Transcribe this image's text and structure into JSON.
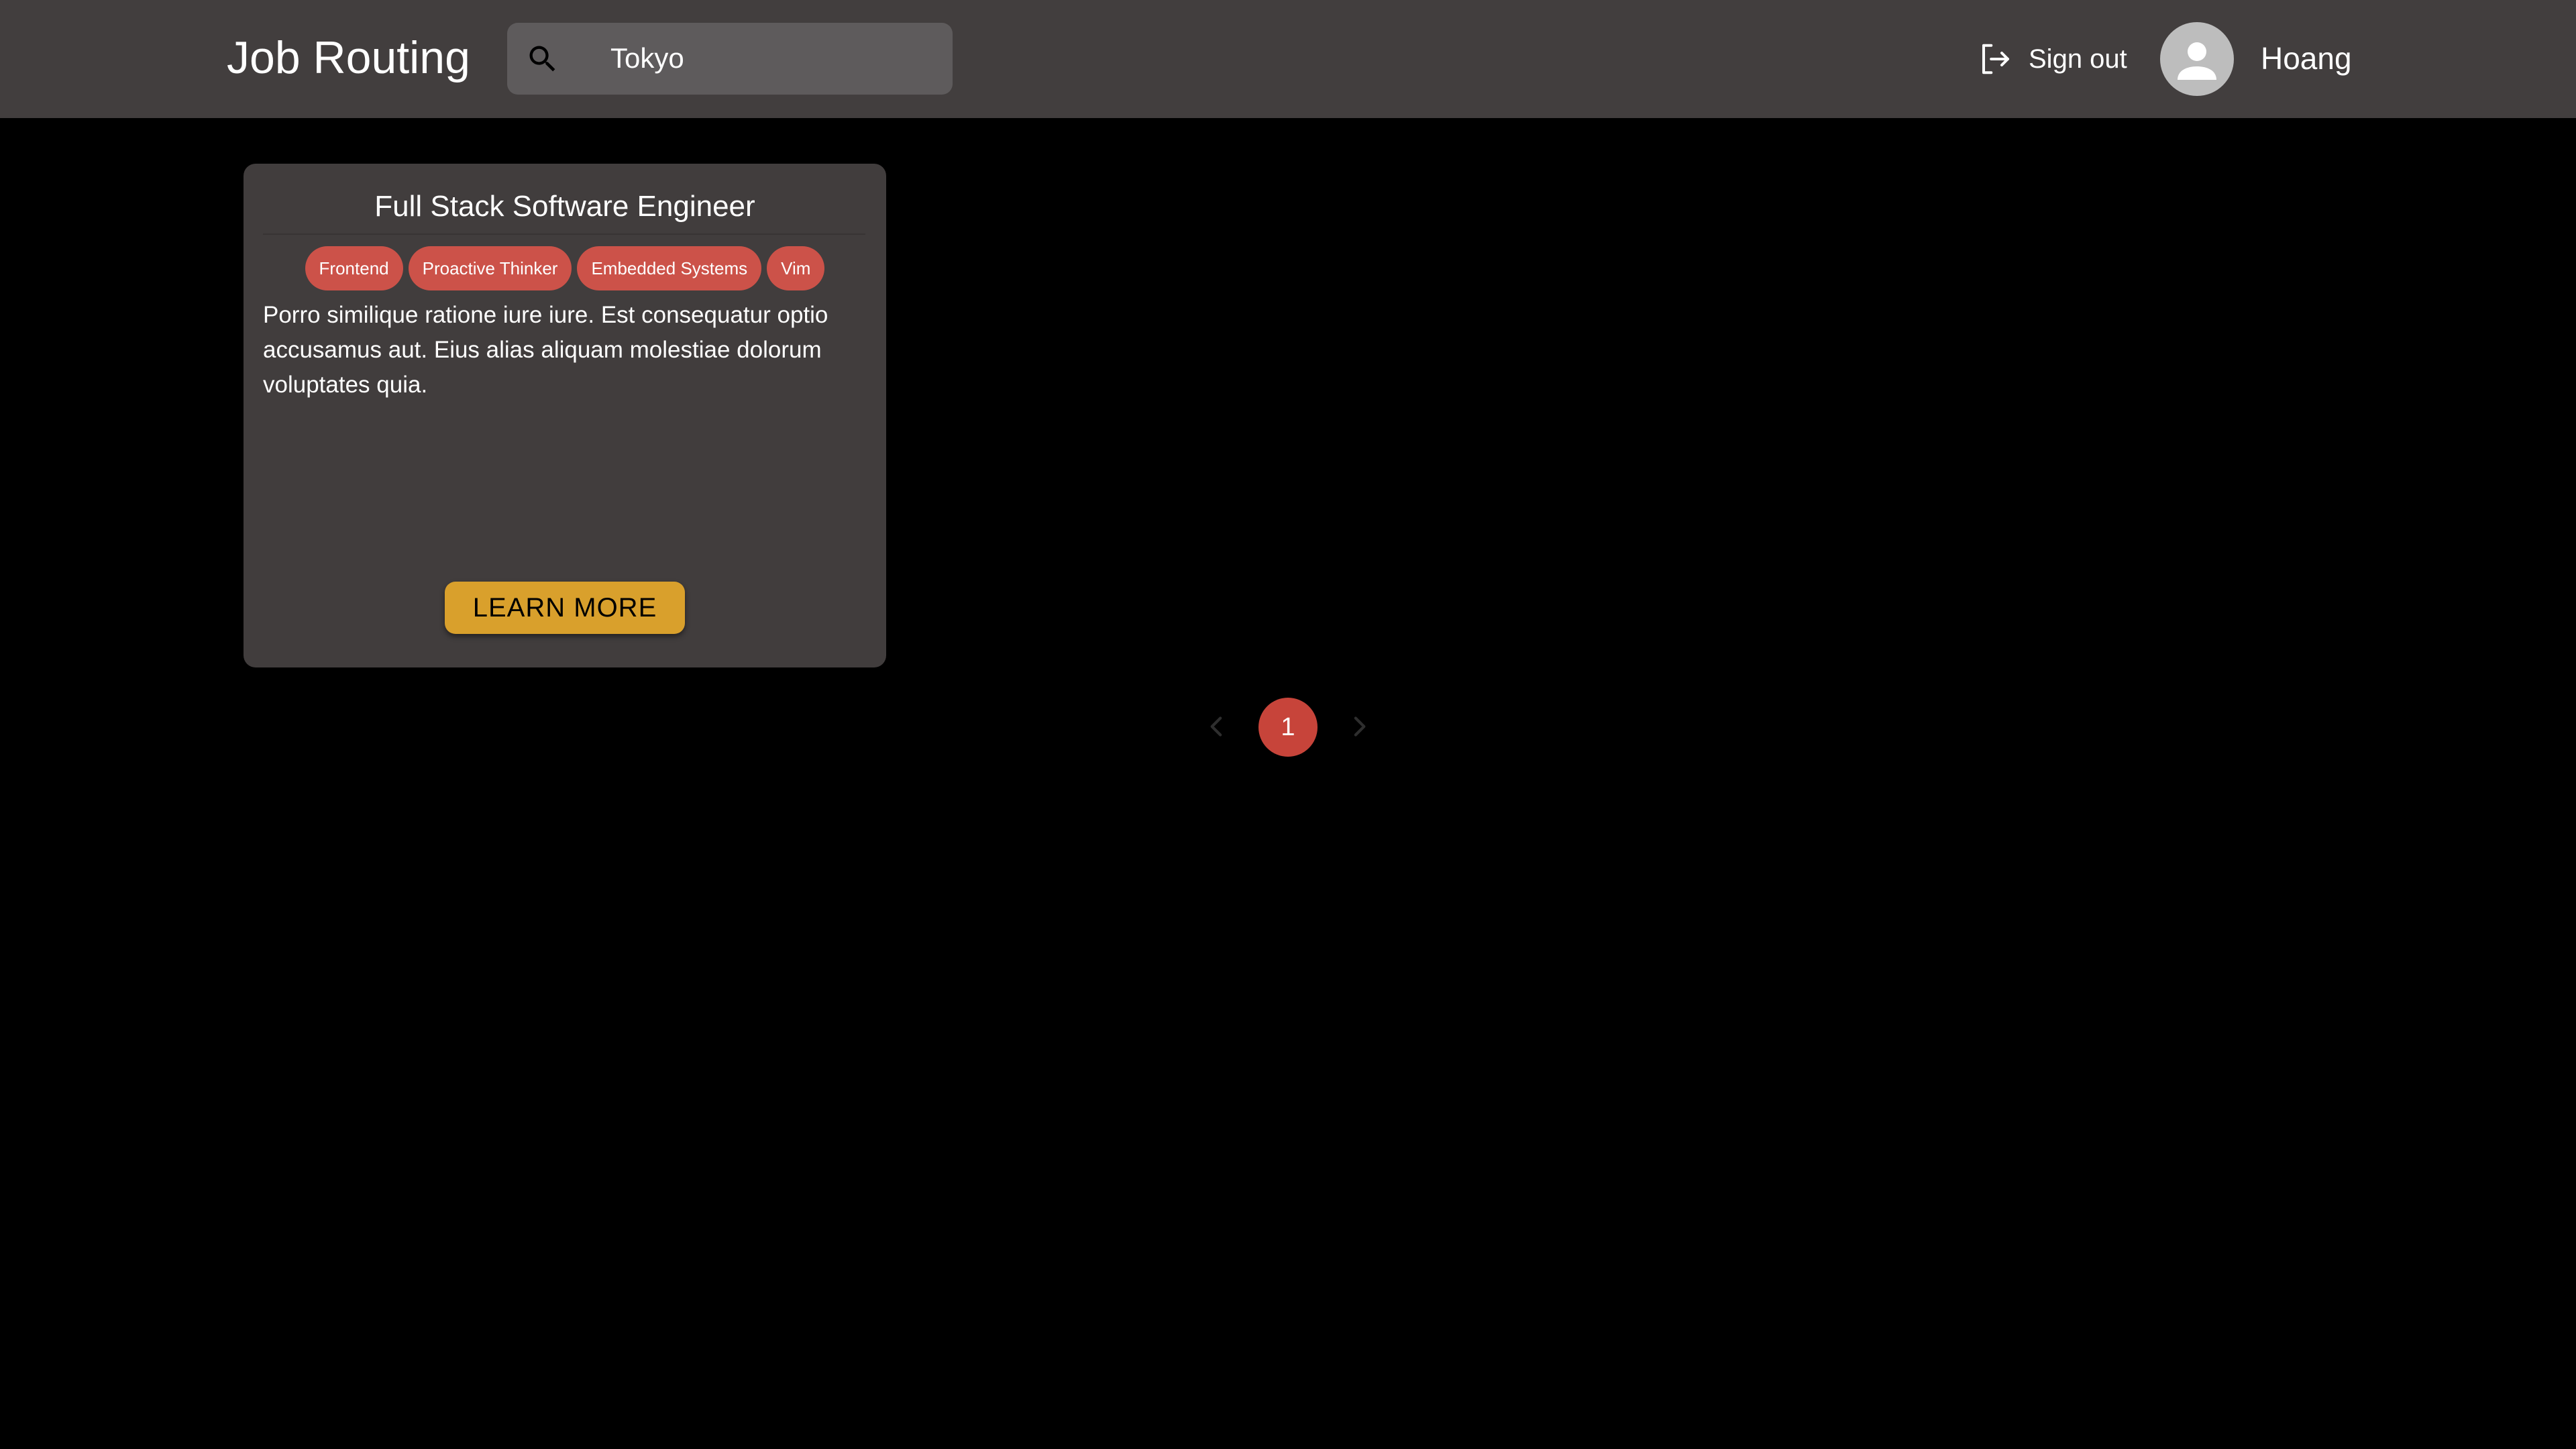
{
  "header": {
    "app_title": "Job Routing",
    "search": {
      "icon": "search-icon",
      "value": "Tokyo",
      "placeholder": ""
    },
    "sign_out": {
      "icon": "logout-icon",
      "label": "Sign out"
    },
    "user": {
      "avatar_icon": "person-icon",
      "name": "Hoang"
    }
  },
  "jobs": [
    {
      "title": "Full Stack Software Engineer",
      "tags": [
        "Frontend",
        "Proactive Thinker",
        "Embedded Systems",
        "Vim"
      ],
      "description": "Porro similique ratione iure iure. Est consequatur optio accusamus aut. Eius alias aliquam molestiae dolorum voluptates quia.",
      "button_label": "LEARN MORE"
    }
  ],
  "pagination": {
    "current_page": "1",
    "prev_icon": "chevron-left-icon",
    "next_icon": "chevron-right-icon"
  },
  "colors": {
    "header_bg": "#423e3e",
    "card_bg": "#413d3d",
    "search_bg": "#5e5b5c",
    "tag_bg": "#cc5249",
    "button_bg": "#d9a02c",
    "active_page_bg": "#c7443a",
    "avatar_bg": "#bdbdbd"
  }
}
